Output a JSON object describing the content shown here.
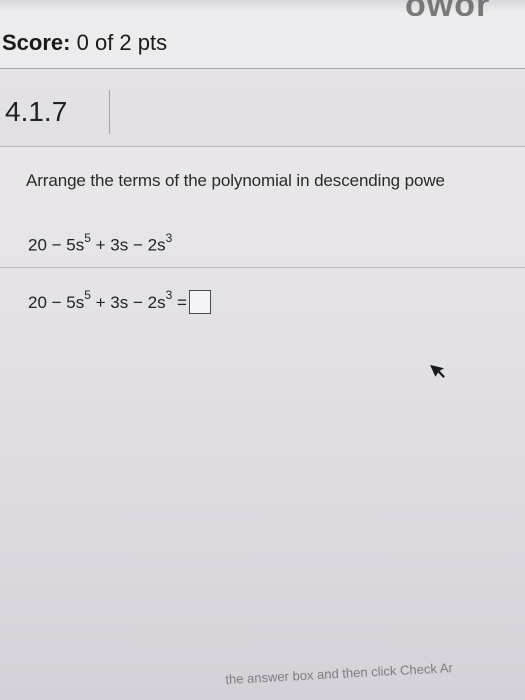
{
  "header": {
    "score_label": "Score:",
    "score_value": "0 of 2 pts",
    "logo_text": "owor"
  },
  "question": {
    "number": "4.1.7",
    "instruction": "Arrange the terms of the polynomial in descending powe",
    "expression": {
      "c1": "20 − 5s",
      "e1": "5",
      "c2": " + 3s − 2s",
      "e2": "3"
    },
    "equation_suffix": "=",
    "answer_value": ""
  },
  "footer": {
    "hint": "the answer box and then click Check Ar"
  }
}
